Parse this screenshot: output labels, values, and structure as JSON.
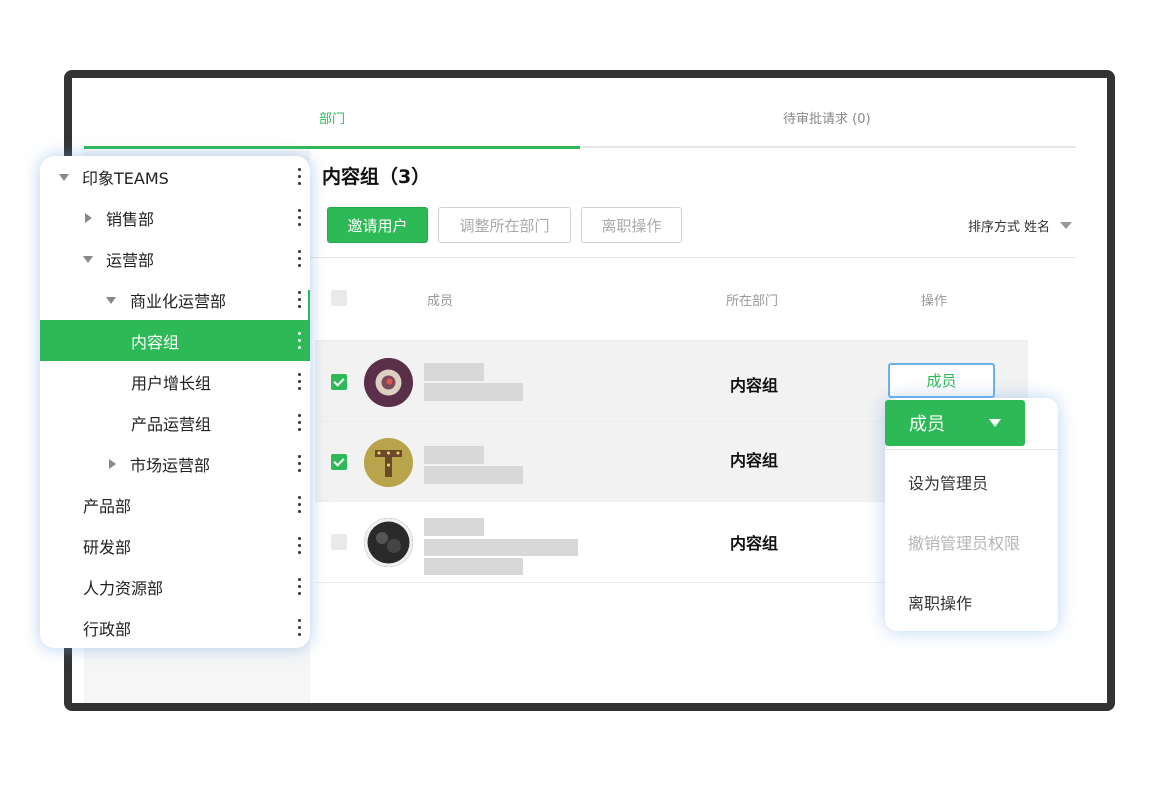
{
  "tabs": {
    "department": "部门",
    "pending": "待审批请求 (0)"
  },
  "tree": {
    "items": [
      {
        "label": "印象TEAMS"
      },
      {
        "label": "销售部"
      },
      {
        "label": "运营部"
      },
      {
        "label": "商业化运营部"
      },
      {
        "label": "内容组",
        "active": true
      },
      {
        "label": "用户增长组"
      },
      {
        "label": "产品运营组"
      },
      {
        "label": "市场运营部"
      },
      {
        "label": "产品部"
      },
      {
        "label": "研发部"
      },
      {
        "label": "人力资源部"
      },
      {
        "label": "行政部"
      }
    ]
  },
  "main": {
    "group_title": "内容组（3）",
    "buttons": {
      "invite": "邀请用户",
      "adjust": "调整所在部门",
      "resign": "离职操作"
    },
    "sort": {
      "label": "排序方式",
      "value": "姓名"
    },
    "table": {
      "headers": {
        "member": "成员",
        "department": "所在部门",
        "action": "操作"
      },
      "rows": [
        {
          "department": "内容组",
          "checked": true,
          "role": "成员"
        },
        {
          "department": "内容组",
          "checked": true
        },
        {
          "department": "内容组",
          "checked": false
        }
      ]
    },
    "role_dropdown": {
      "selected": "成员",
      "options": [
        {
          "label": "设为管理员",
          "disabled": false
        },
        {
          "label": "撤销管理员权限",
          "disabled": true
        },
        {
          "label": "离职操作",
          "disabled": false
        }
      ]
    }
  },
  "colors": {
    "accent": "#2dba56",
    "focus": "#6ab1e8"
  }
}
